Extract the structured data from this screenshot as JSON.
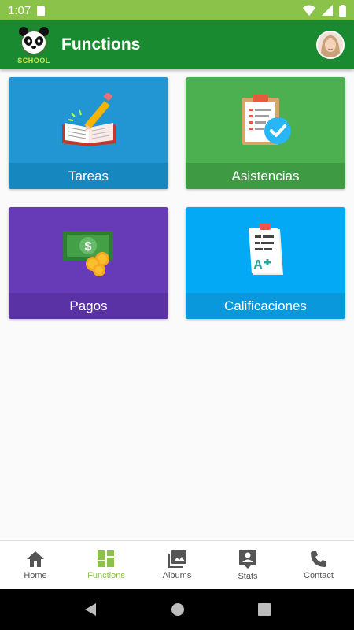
{
  "status_bar": {
    "time": "1:07"
  },
  "app_bar": {
    "title": "Functions",
    "logo_text": "SCHOOL"
  },
  "cards": [
    {
      "label": "Tareas",
      "icon": "book-pencil-icon",
      "top_color": "#2196d3",
      "label_color": "#1787c0"
    },
    {
      "label": "Asistencias",
      "icon": "clipboard-check-icon",
      "top_color": "#4caf50",
      "label_color": "#3f9a44"
    },
    {
      "label": "Pagos",
      "icon": "money-coins-icon",
      "top_color": "#673ab7",
      "label_color": "#5b32a6"
    },
    {
      "label": "Calificaciones",
      "icon": "grade-sheet-icon",
      "top_color": "#03a9f4",
      "label_color": "#0a98dd"
    }
  ],
  "bottom_nav": [
    {
      "label": "Home",
      "icon": "home-icon"
    },
    {
      "label": "Functions",
      "icon": "dashboard-icon",
      "active": true
    },
    {
      "label": "Albums",
      "icon": "photo-library-icon"
    },
    {
      "label": "Stats",
      "icon": "account-box-icon"
    },
    {
      "label": "Contact",
      "icon": "phone-icon"
    }
  ],
  "colors": {
    "status_bar": "#8bc34a",
    "app_bar": "#1a8a30",
    "active_nav": "#8bc34a"
  }
}
